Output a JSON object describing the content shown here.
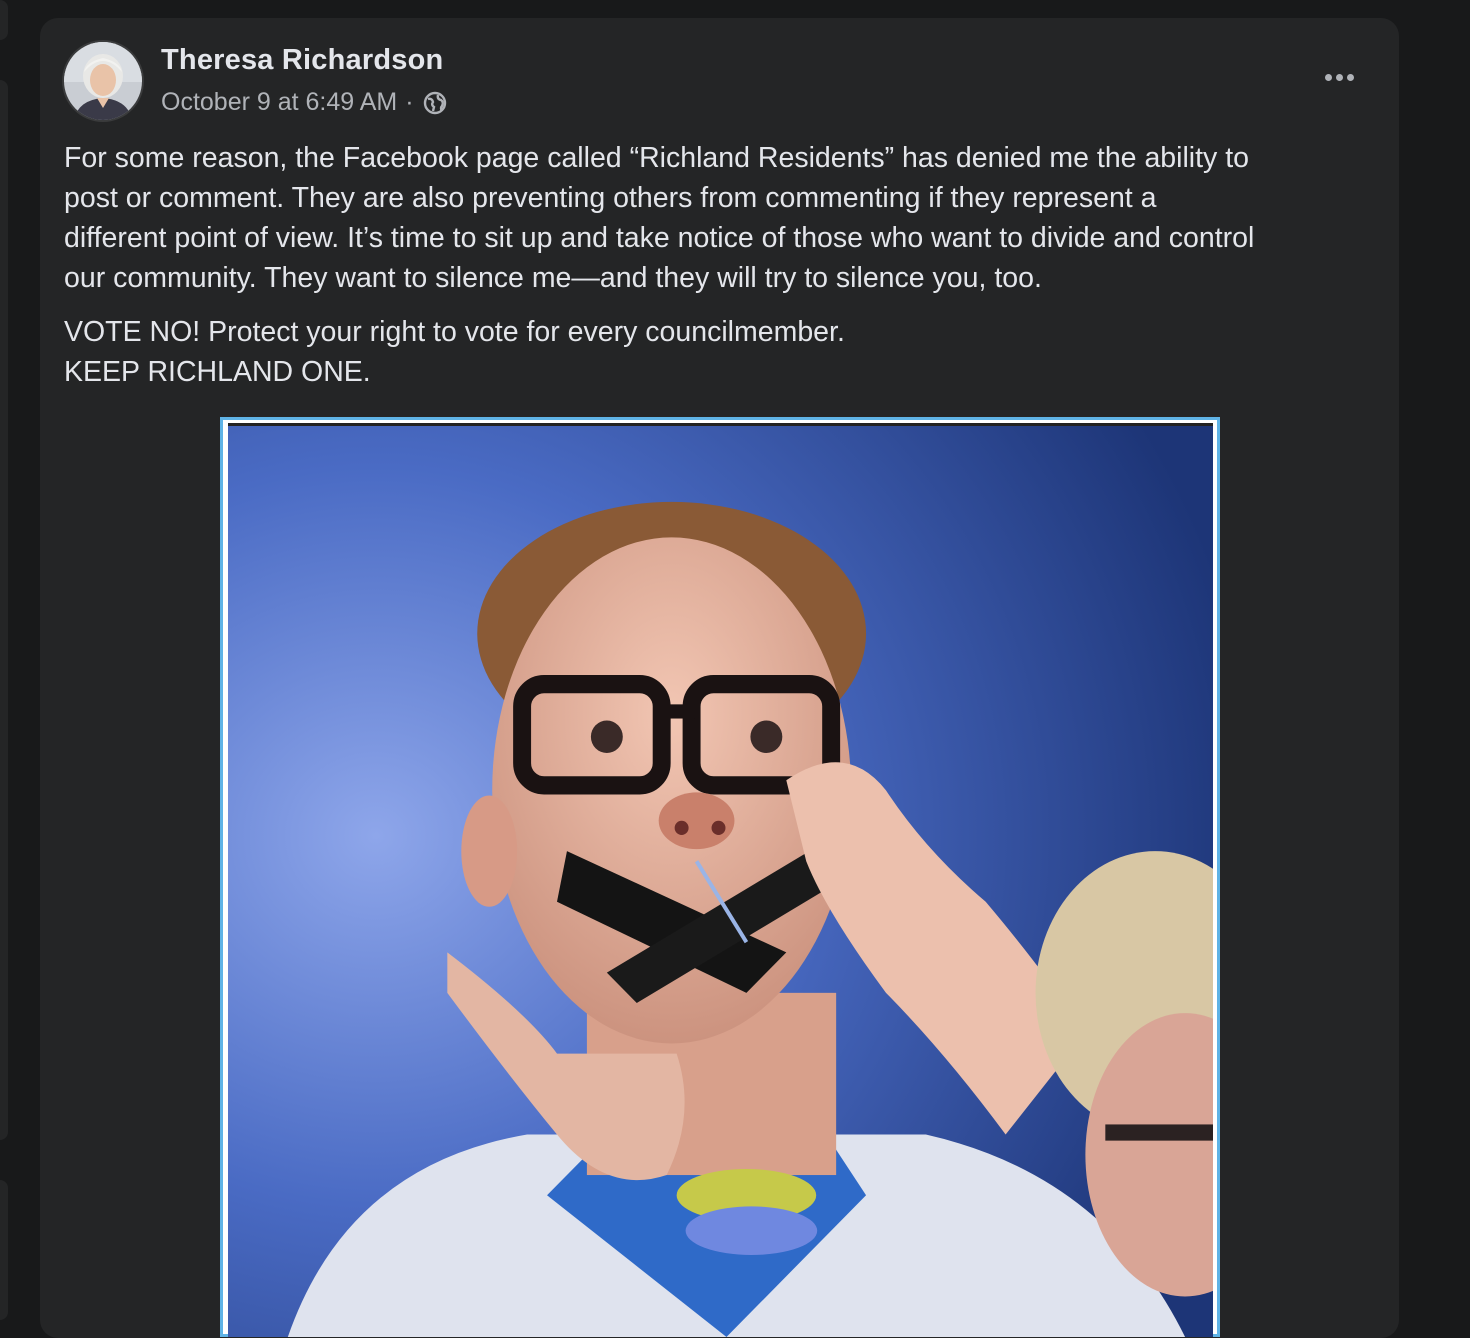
{
  "post": {
    "author": "Theresa Richardson",
    "timestamp": "October 9 at 6:49 AM",
    "separator": "·",
    "privacy_icon": "globe-icon",
    "menu_icon": "more-horizontal-icon",
    "body": {
      "paragraph1": [
        "For some reason, the Facebook page called “Richland Residents” has denied me the ability to",
        "post or comment. They are also preventing others from commenting if they represent a",
        "different point of view. It’s time to sit up and take notice of those who want to divide and control",
        "our community. They want to silence me—and they will try to silence you, too."
      ],
      "paragraph2": [
        "VOTE NO! Protect your right to vote for every councilmember.",
        "KEEP RICHLAND ONE."
      ]
    },
    "media": {
      "type": "gif",
      "subject": "man in glasses having his mouth taped shut"
    }
  },
  "colors": {
    "page_bg": "#18191a",
    "card_bg": "#242526",
    "primary_text": "#e4e6eb",
    "secondary_text": "#b0b3b8",
    "media_border": "#5fb3e6"
  }
}
